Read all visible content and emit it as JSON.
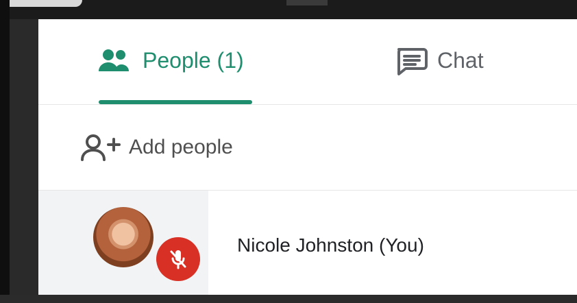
{
  "tabs": {
    "people_label": "People (1)",
    "chat_label": "Chat"
  },
  "actions": {
    "add_people_label": "Add people"
  },
  "participants": [
    {
      "name": "Nicole Johnston (You)"
    }
  ],
  "icons": {
    "people": "people-icon",
    "chat": "chat-icon",
    "add_person": "add-person-icon",
    "mic_off": "mic-off-icon"
  },
  "colors": {
    "accent": "#1e8e6e",
    "muted_text": "#5f6368",
    "mute_badge": "#d93025"
  }
}
